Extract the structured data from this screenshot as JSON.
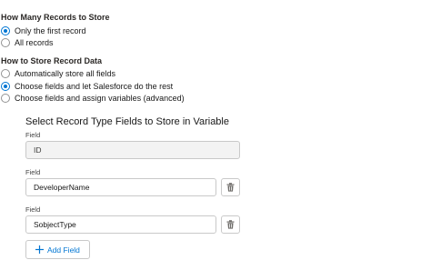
{
  "how_many": {
    "title": "How Many Records to Store",
    "options": [
      {
        "label": "Only the first record",
        "checked": true
      },
      {
        "label": "All records",
        "checked": false
      }
    ]
  },
  "how_to_store": {
    "title": "How to Store Record Data",
    "options": [
      {
        "label": "Automatically store all fields",
        "checked": false
      },
      {
        "label": "Choose fields and let Salesforce do the rest",
        "checked": true
      },
      {
        "label": "Choose fields and assign variables (advanced)",
        "checked": false
      }
    ]
  },
  "fields_section": {
    "title": "Select Record Type Fields to Store in Variable",
    "fields": [
      {
        "label": "Field",
        "value": "ID",
        "disabled": true
      },
      {
        "label": "Field",
        "value": "DeveloperName",
        "disabled": false
      },
      {
        "label": "Field",
        "value": "SobjectType",
        "disabled": false
      }
    ],
    "add_button_label": "Add Field"
  },
  "icons": {
    "delete": "trash-icon",
    "add": "plus-icon"
  },
  "colors": {
    "accent": "#0176d3",
    "text": "#181818",
    "border": "#c9c9c9",
    "disabled_bg": "#f3f3f3"
  }
}
